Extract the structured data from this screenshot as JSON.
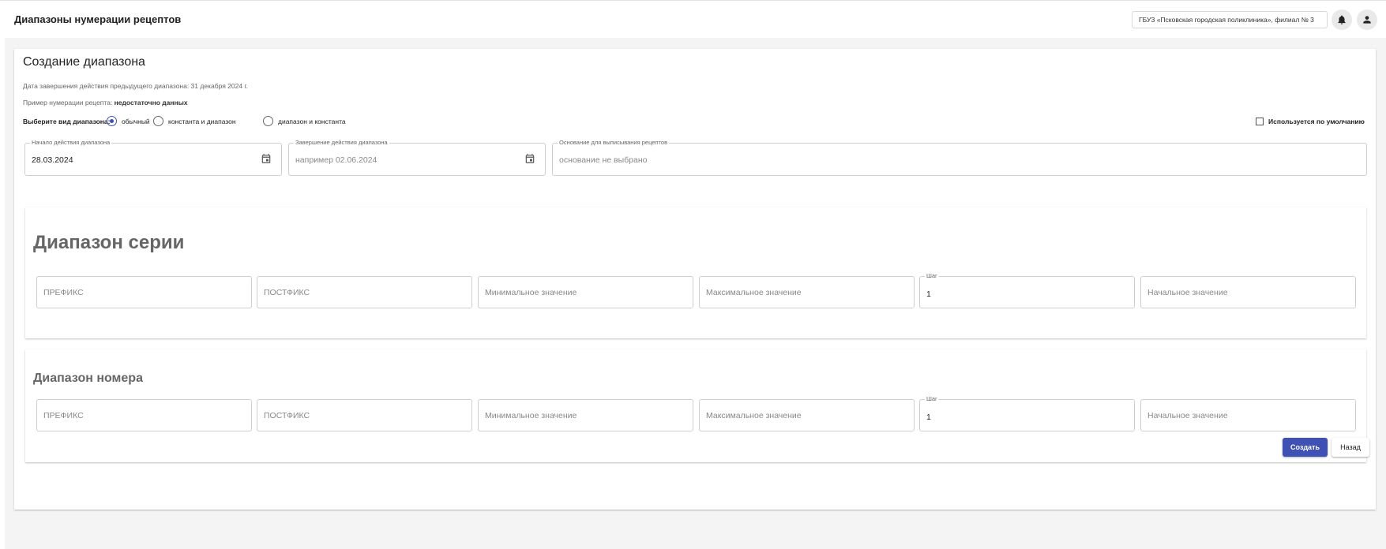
{
  "header": {
    "title": "Диапазоны нумерации рецептов",
    "organization": "ГБУЗ «Псковская городская поликлиника», филиал № 3"
  },
  "card": {
    "title": "Создание диапазона",
    "prev_range_end_label": "Дата завершения действия предыдущего диапазона: 31 декабря 2024 г.",
    "example_label": "Пример нумерации рецепта: ",
    "example_value": "недостаточно данных",
    "range_type_label": "Выберите вид диапазона:",
    "range_types": [
      {
        "label": "обычный",
        "selected": true
      },
      {
        "label": "константа и диапазон",
        "selected": false
      },
      {
        "label": "диапазон и константа",
        "selected": false
      }
    ],
    "default_checkbox": {
      "label": "Используется по умолчанию",
      "checked": false
    },
    "start_date": {
      "label": "Начало действия диапазона",
      "value": "28.03.2024"
    },
    "end_date": {
      "label": "Завершение действия диапазона",
      "placeholder": "например 02.06.2024"
    },
    "basis": {
      "label": "Основание для выписывания рецептов",
      "placeholder": "основание не выбрано"
    }
  },
  "series_section": {
    "title": "Диапазон серии",
    "fields": {
      "prefix": "ПРЕФИКС",
      "postfix": "ПОСТФИКС",
      "min": "Минимальное значение",
      "max": "Максимальное значение",
      "step_label": "Шаг",
      "step_value": "1",
      "initial": "Начальное значение"
    }
  },
  "number_section": {
    "title": "Диапазон номера",
    "fields": {
      "prefix": "ПРЕФИКС",
      "postfix": "ПОСТФИКС",
      "min": "Минимальное значение",
      "max": "Максимальное значение",
      "step_label": "Шаг",
      "step_value": "1",
      "initial": "Начальное значение"
    }
  },
  "actions": {
    "create": "Создать",
    "back": "Назад"
  },
  "colors": {
    "accent": "#3f51b5",
    "background": "#f4f4f4"
  }
}
